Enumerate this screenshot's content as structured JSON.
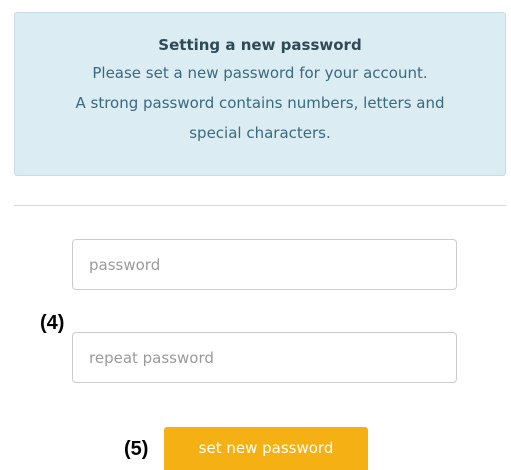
{
  "info": {
    "title": "Setting a new password",
    "line1": "Please set a new password for your account.",
    "line2": "A strong password contains numbers, letters and",
    "line3": "special characters."
  },
  "form": {
    "password_placeholder": "password",
    "repeat_placeholder": "repeat password",
    "submit_label": "set new password"
  },
  "annotations": {
    "step4": "(4)",
    "step5": "(5)"
  },
  "colors": {
    "info_background": "#dcecf3",
    "button_background": "#f5b114",
    "button_text": "#ffffff"
  }
}
